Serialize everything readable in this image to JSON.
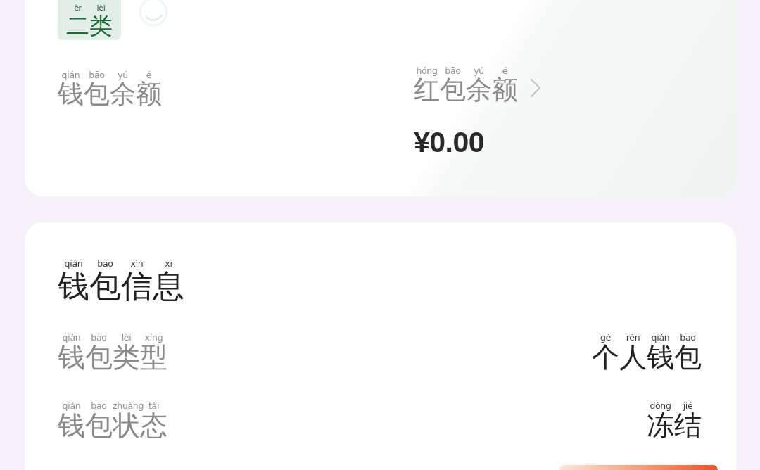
{
  "summary_card": {
    "badge": {
      "text": "二类",
      "pinyin": [
        "èr",
        "lèi"
      ]
    },
    "wallet_balance": {
      "label": {
        "text": "钱包余额",
        "pinyin": [
          "qián",
          "bāo",
          "yú",
          "é"
        ]
      }
    },
    "red_packet_balance": {
      "label": {
        "text": "红包余额",
        "pinyin": [
          "hóng",
          "bāo",
          "yú",
          "é"
        ]
      },
      "amount": "¥0.00"
    }
  },
  "info_card": {
    "title": {
      "text": "钱包信息",
      "pinyin": [
        "qián",
        "bāo",
        "xìn",
        "xī"
      ]
    },
    "rows": [
      {
        "label": {
          "text": "钱包类型",
          "pinyin": [
            "qián",
            "bāo",
            "lèi",
            "xíng"
          ]
        },
        "value": {
          "text": "个人钱包",
          "pinyin": [
            "gè",
            "rén",
            "qián",
            "bāo"
          ]
        }
      },
      {
        "label": {
          "text": "钱包状态",
          "pinyin": [
            "qián",
            "bāo",
            "zhuàng",
            "tài"
          ]
        },
        "value": {
          "text": "冻结",
          "pinyin": [
            "dòng",
            "jié"
          ]
        }
      }
    ]
  }
}
